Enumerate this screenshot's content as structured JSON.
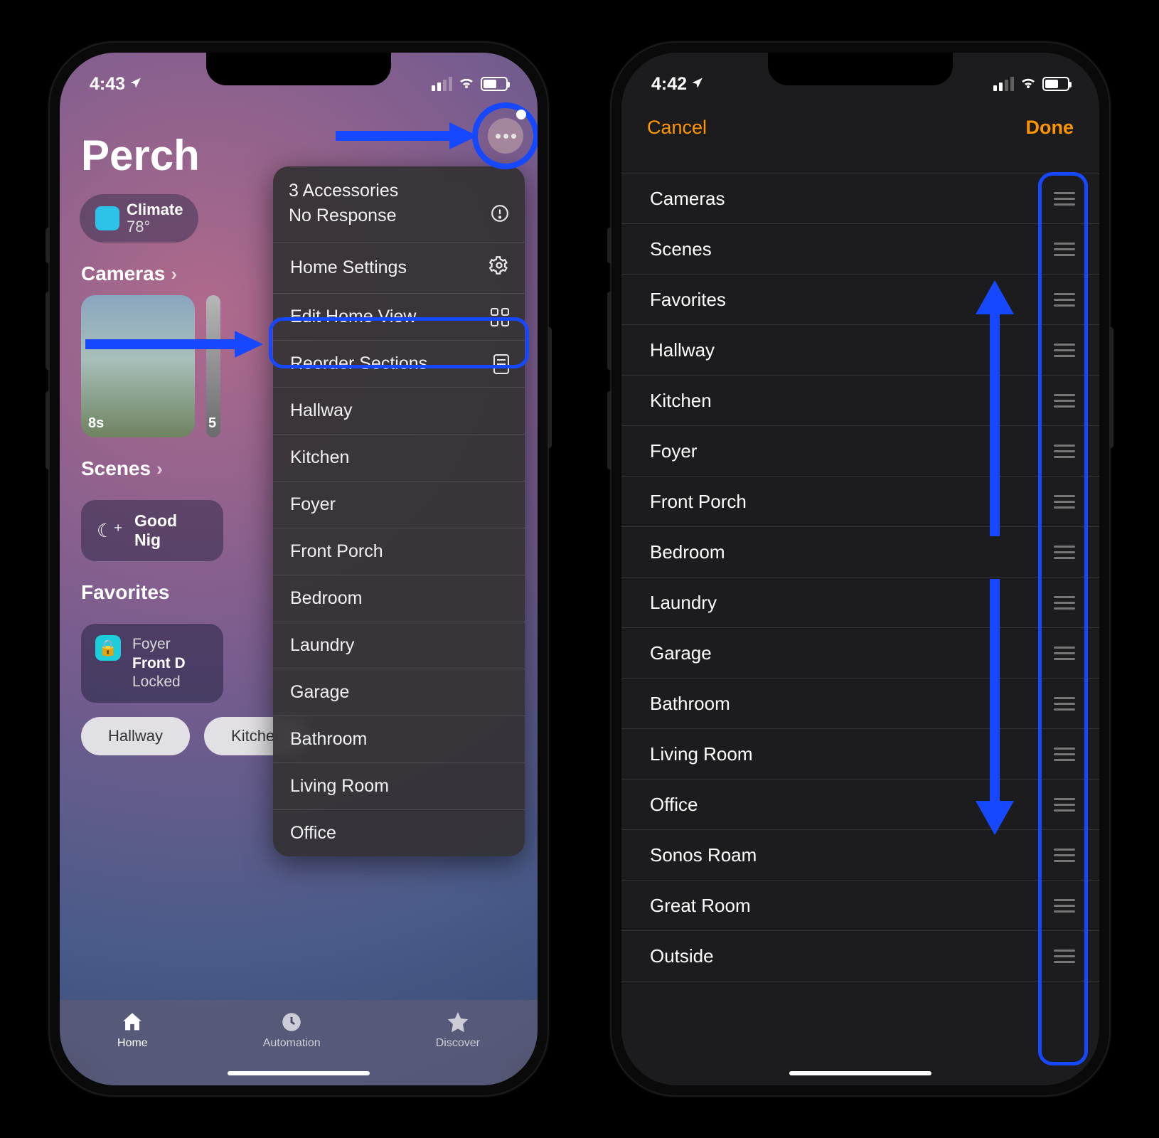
{
  "left": {
    "status": {
      "time": "4:43",
      "location_on": true
    },
    "home_title": "Perch",
    "climate_chip": {
      "label": "Climate",
      "value": "78°"
    },
    "sections": {
      "cameras": {
        "label": "Cameras",
        "tile1_ts": "8s",
        "tile2_ts": "5"
      },
      "scenes": {
        "label": "Scenes",
        "item1": "Good Nig"
      },
      "favorites": {
        "label": "Favorites",
        "fav_sub": "Foyer",
        "fav_main": "Front D",
        "fav_state": "Locked"
      },
      "room_chips": [
        "Hallway",
        "Kitchen"
      ]
    },
    "menu": {
      "accessories_line1": "3 Accessories",
      "accessories_line2": "No Response",
      "home_settings": "Home Settings",
      "edit_home_view": "Edit Home View",
      "reorder_sections": "Reorder Sections",
      "rooms": [
        "Hallway",
        "Kitchen",
        "Foyer",
        "Front Porch",
        "Bedroom",
        "Laundry",
        "Garage",
        "Bathroom",
        "Living Room",
        "Office"
      ]
    },
    "tabs": {
      "home": "Home",
      "automation": "Automation",
      "discover": "Discover"
    }
  },
  "right": {
    "status": {
      "time": "4:42"
    },
    "header": {
      "cancel": "Cancel",
      "done": "Done"
    },
    "items": [
      "Cameras",
      "Scenes",
      "Favorites",
      "Hallway",
      "Kitchen",
      "Foyer",
      "Front Porch",
      "Bedroom",
      "Laundry",
      "Garage",
      "Bathroom",
      "Living Room",
      "Office",
      "Sonos Roam",
      "Great Room",
      "Outside"
    ]
  }
}
